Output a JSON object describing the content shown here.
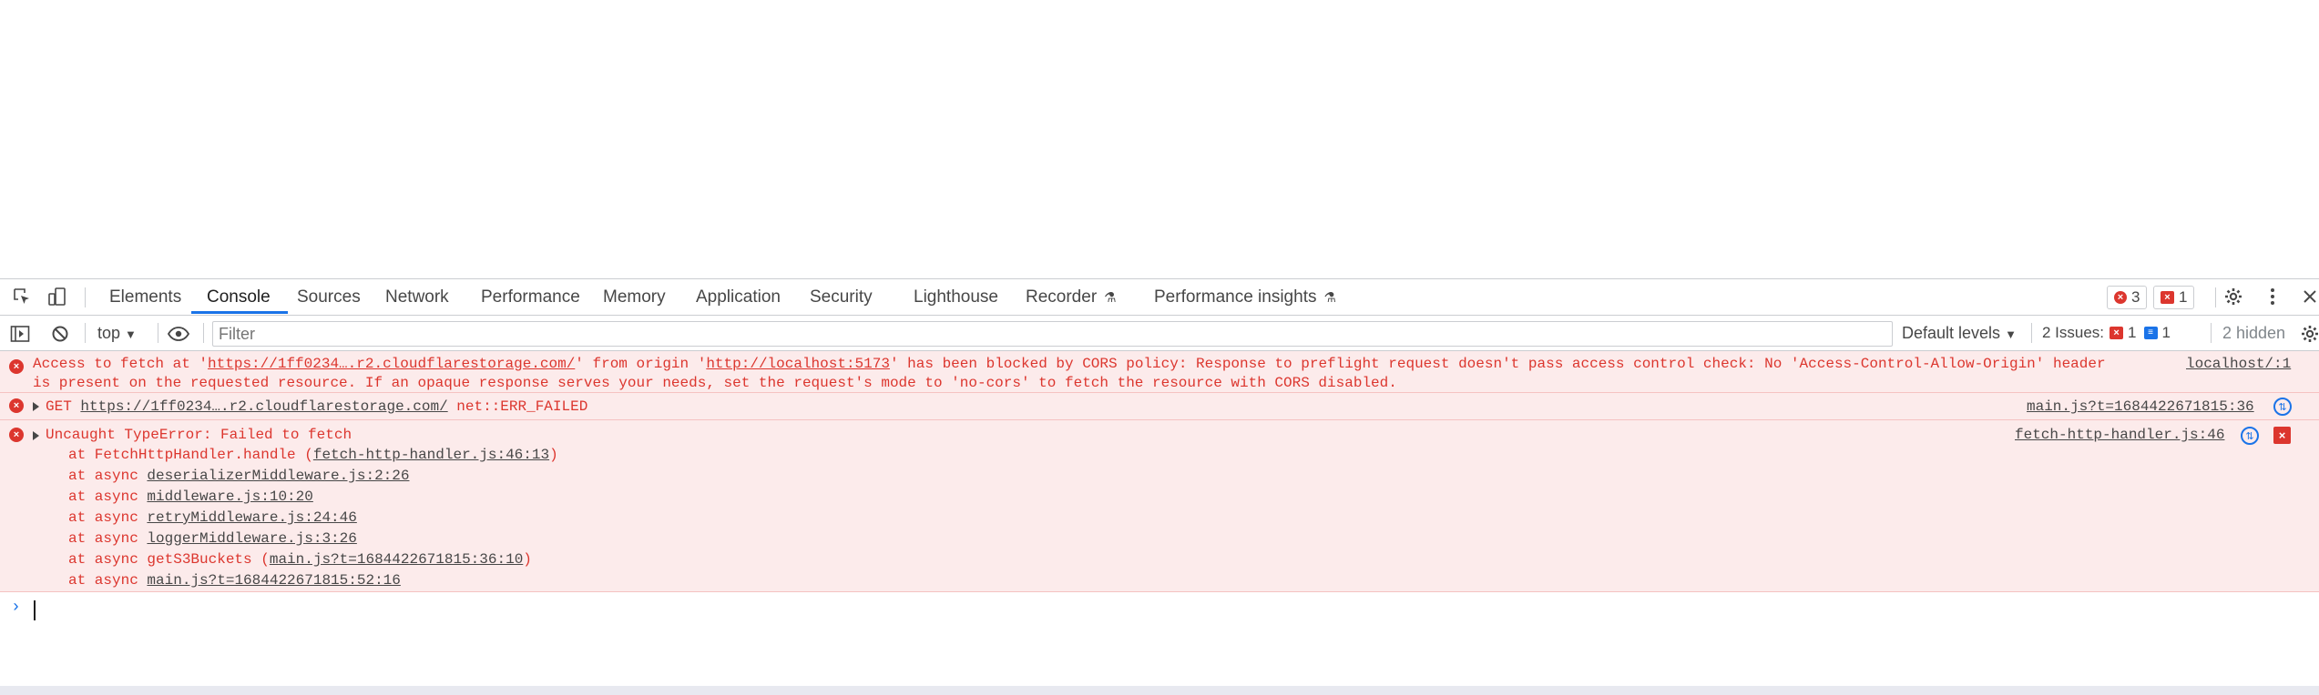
{
  "devtools": {
    "tabs": [
      {
        "label": "Elements"
      },
      {
        "label": "Console"
      },
      {
        "label": "Sources"
      },
      {
        "label": "Network"
      },
      {
        "label": "Performance"
      },
      {
        "label": "Memory"
      },
      {
        "label": "Application"
      },
      {
        "label": "Security"
      },
      {
        "label": "Lighthouse"
      },
      {
        "label": "Recorder"
      },
      {
        "label": "Performance insights"
      }
    ],
    "error_count": "3",
    "issue_count": "1"
  },
  "console_toolbar": {
    "context": "top",
    "filter_placeholder": "Filter",
    "levels": "Default levels",
    "issues_label": "2 Issues:",
    "issues_error": "1",
    "issues_info": "1",
    "hidden": "2 hidden"
  },
  "messages": {
    "cors": {
      "p1": "Access to fetch at '",
      "url1": "https://1ff0234….r2.cloudflarestorage.com/",
      "p2": "' from origin '",
      "url2": "http://localhost:5173",
      "p3": "' has been blocked by CORS policy: Response to preflight request doesn't pass access control check: No 'Access-Control-Allow-Origin' header",
      "line2": "is present on the requested resource. If an opaque response serves your needs, set the request's mode to 'no-cors' to fetch the resource with CORS disabled.",
      "source": "localhost/:1"
    },
    "get": {
      "method": "GET ",
      "url": "https://1ff0234….r2.cloudflarestorage.com/",
      "error": " net::ERR_FAILED",
      "source": "main.js?t=1684422671815:36"
    },
    "typeerror": {
      "title": "Uncaught TypeError: Failed to fetch",
      "source": "fetch-http-handler.js:46",
      "stack": [
        {
          "prefix": "at FetchHttpHandler.handle (",
          "link": "fetch-http-handler.js:46:13",
          "suffix": ")"
        },
        {
          "prefix": "at async ",
          "link": "deserializerMiddleware.js:2:26",
          "suffix": ""
        },
        {
          "prefix": "at async ",
          "link": "middleware.js:10:20",
          "suffix": ""
        },
        {
          "prefix": "at async ",
          "link": "retryMiddleware.js:24:46",
          "suffix": ""
        },
        {
          "prefix": "at async ",
          "link": "loggerMiddleware.js:3:26",
          "suffix": ""
        },
        {
          "prefix": "at async getS3Buckets (",
          "link": "main.js?t=1684422671815:36:10",
          "suffix": ")"
        },
        {
          "prefix": "at async ",
          "link": "main.js?t=1684422671815:52:16",
          "suffix": ""
        }
      ]
    }
  },
  "colors": {
    "error_text": "#dc362e",
    "error_bg": "#fcebeb",
    "accent": "#1a73e8"
  }
}
